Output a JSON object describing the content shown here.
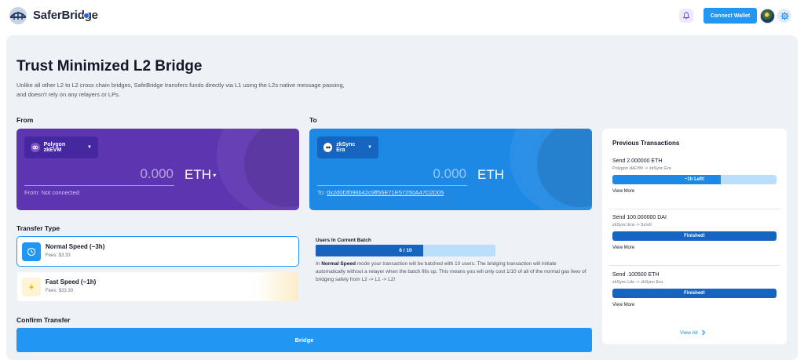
{
  "header": {
    "brand": "SaferBridge",
    "connect_label": "Connect Wallet",
    "icons": {
      "logo": "bridge-logo-icon",
      "bell": "bell-icon",
      "gear": "gear-icon"
    }
  },
  "hero": {
    "title": "Trust Minimized L2 Bridge",
    "description": "Unlike all other L2 to L2 cross chain bridges, SafeBridge transfers funds directly via L1 using the L2s native message passing, and doesn't rely on any relayers or LPs."
  },
  "from": {
    "label": "From",
    "chain": "Polygon zkEVM",
    "amount": "0.000",
    "token": "ETH",
    "status": "From: Not connected"
  },
  "to": {
    "label": "To",
    "chain": "zkSync Era",
    "amount": "0.000",
    "token": "ETH",
    "address_prefix": "To: ",
    "address": "0x2d0Df096b42c9ff55E71E57250A47D2D05"
  },
  "transfer": {
    "label": "Transfer Type",
    "options": [
      {
        "name": "Normal Speed (~3h)",
        "fee": "Fees: $3.33",
        "selected": true
      },
      {
        "name": "Fast Speed (~1h)",
        "fee": "Fees: $33.30",
        "selected": false
      }
    ]
  },
  "batch": {
    "label": "Users In Current Batch",
    "progress_text": "6 / 10",
    "progress": 0.6,
    "desc_prefix": "In ",
    "desc_bold": "Normal Speed",
    "desc_rest": " mode your transaction will be batched with 10 users. The bridging transaction will initiate automatically without a relayer when the batch fills up. This means you will only cost 1/10 of all of the normal gas fees of bridging safely from L2 -> L1 -> L2!"
  },
  "confirm": {
    "label": "Confirm Transfer",
    "button": "Bridge"
  },
  "previous": {
    "title": "Previous Transactions",
    "view_all": "View All",
    "items": [
      {
        "title": "Send 2.000000 ETH",
        "route": "Polygon zkEVM -> zkSync Era",
        "status": "~1h Left!",
        "progress": 0.66,
        "more": "View More"
      },
      {
        "title": "Send 100.000000 DAI",
        "route": "zkSync Era -> Scroll",
        "status": "Finished!",
        "progress": 1,
        "more": "View More"
      },
      {
        "title": "Send .100500 ETH",
        "route": "zkSync Lite -> zkSync Era",
        "status": "Finished!",
        "progress": 1,
        "more": "View More"
      }
    ]
  },
  "colors": {
    "accent": "#2196f3",
    "from_card": "#5e35b1",
    "to_card": "#1e88e5",
    "progress_dark": "#1565c0",
    "progress_light": "#bbdefb"
  }
}
